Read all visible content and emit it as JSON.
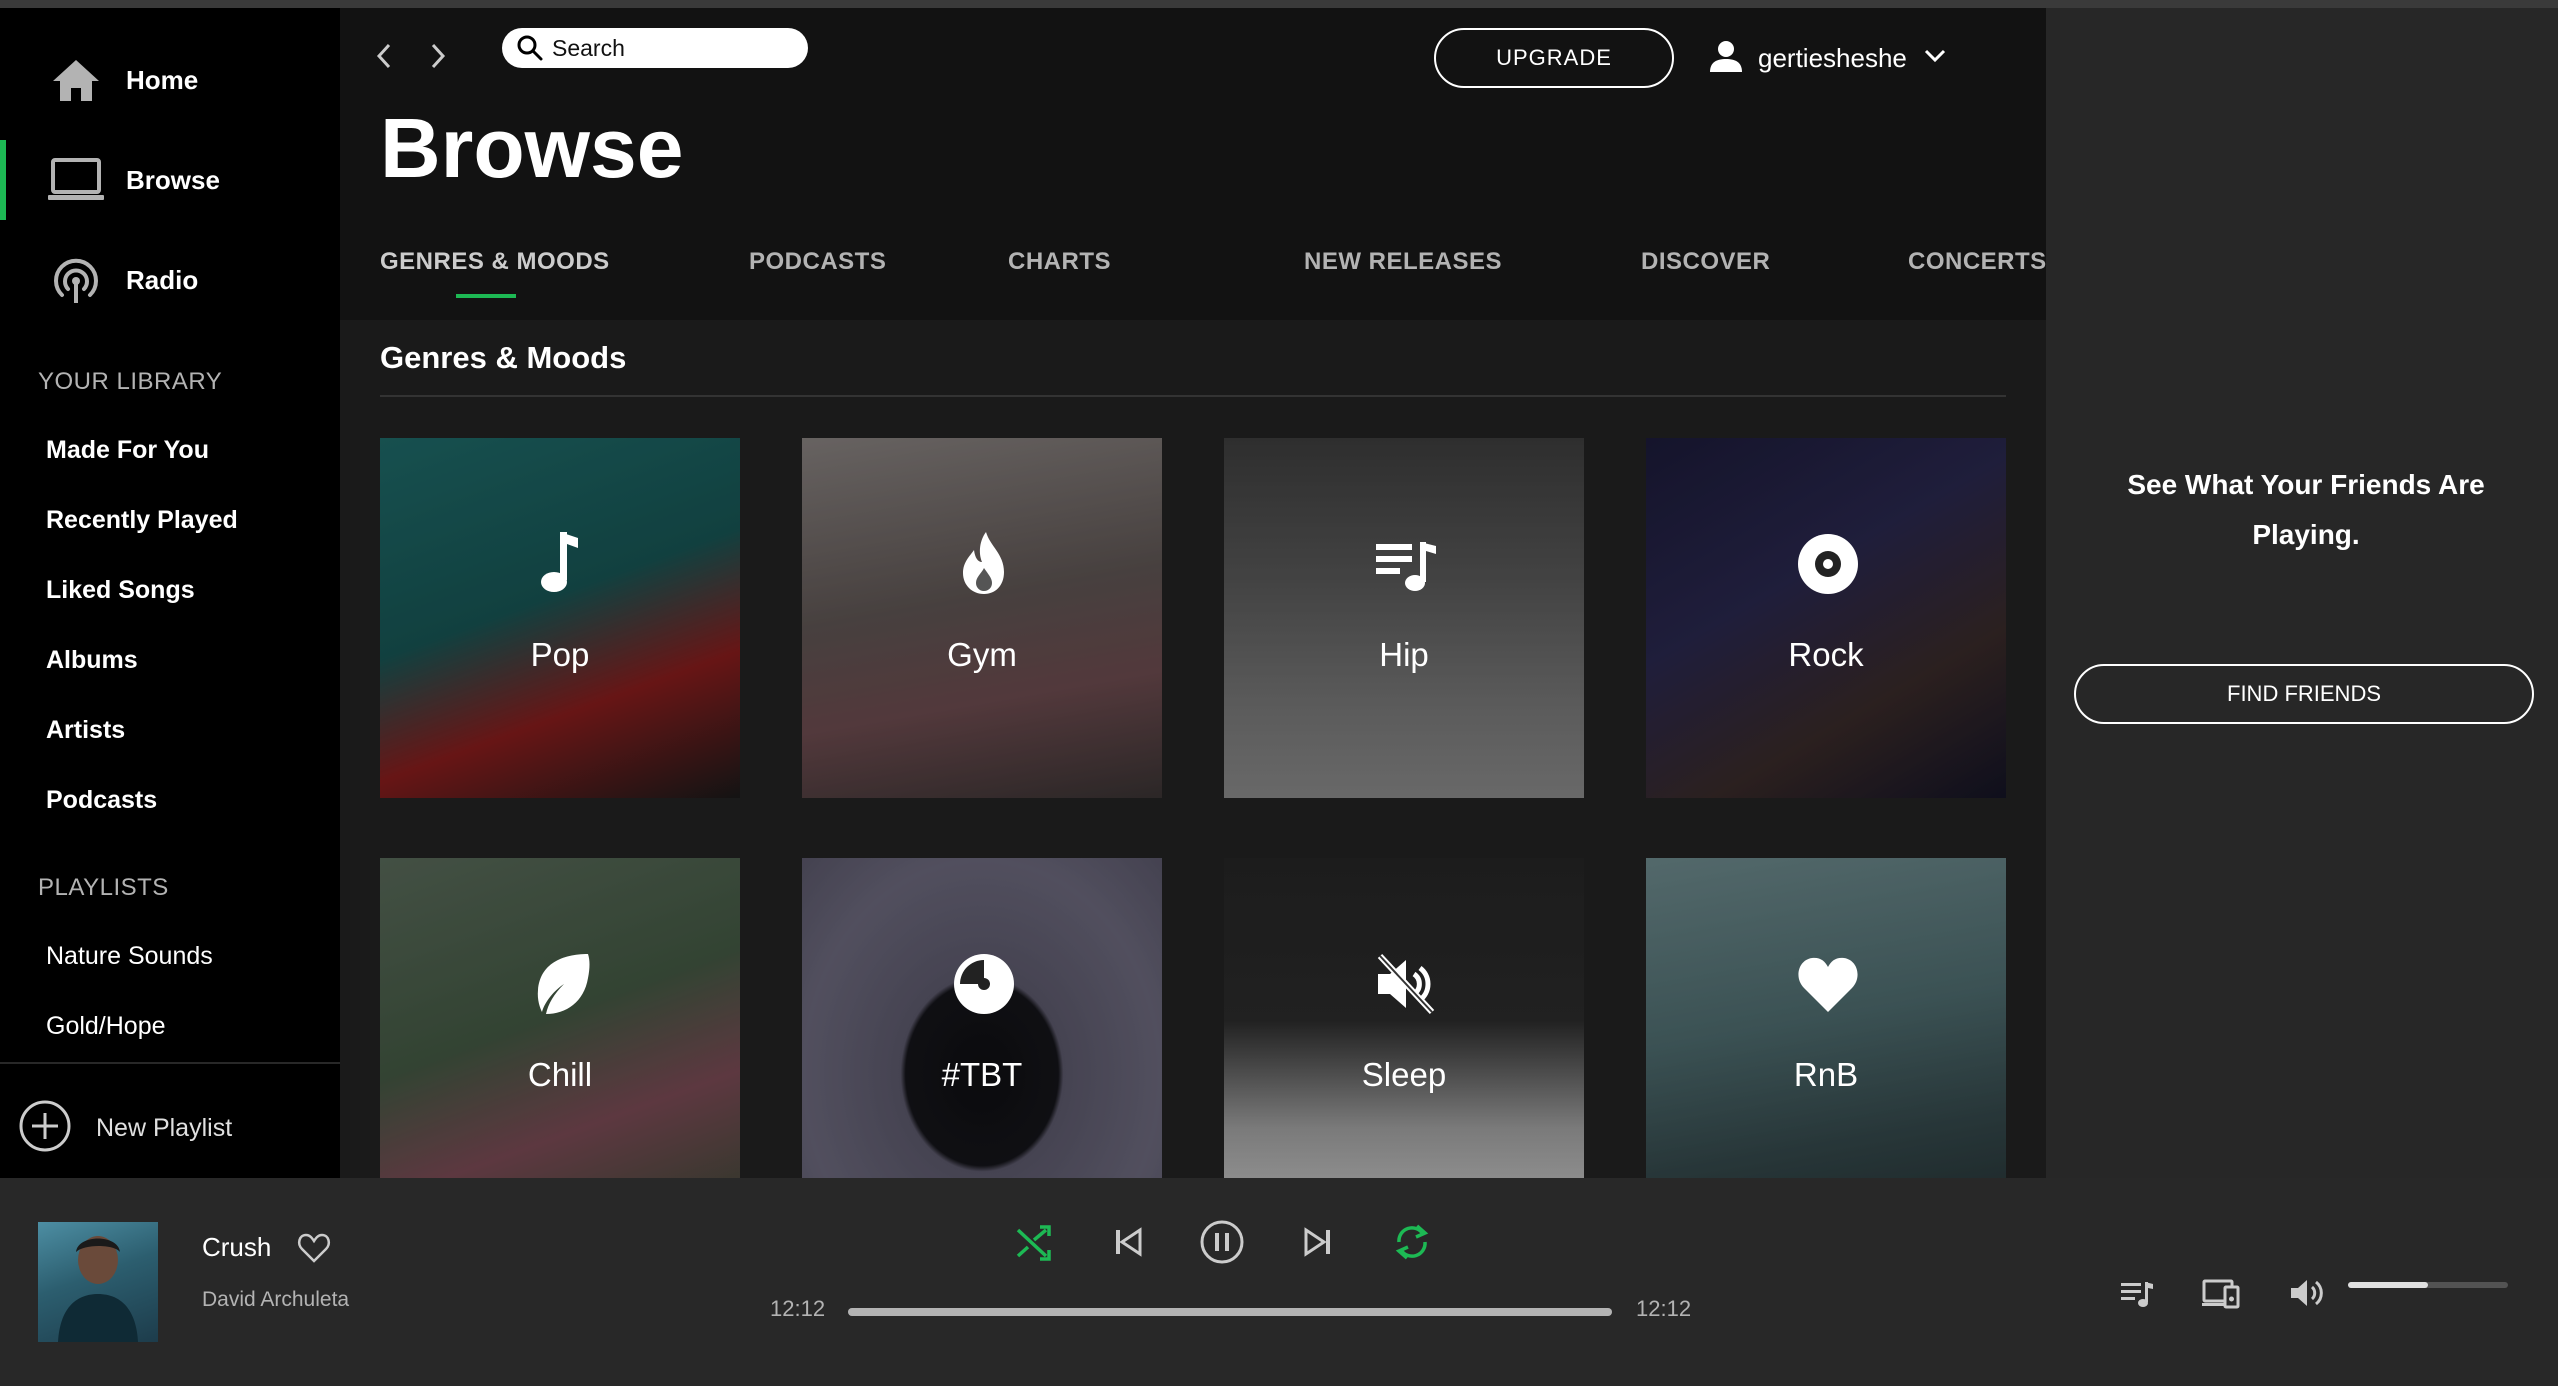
{
  "sidebar": {
    "nav": [
      {
        "label": "Home",
        "icon": "home-icon"
      },
      {
        "label": "Browse",
        "icon": "browse-icon",
        "active": true
      },
      {
        "label": "Radio",
        "icon": "radio-icon"
      }
    ],
    "library_heading": "YOUR LIBRARY",
    "library": [
      "Made For You",
      "Recently Played",
      "Liked Songs",
      "Albums",
      "Artists",
      "Podcasts"
    ],
    "playlists_heading": "PLAYLISTS",
    "playlists": [
      "Nature Sounds",
      "Gold/Hope"
    ],
    "new_playlist": "New Playlist"
  },
  "header": {
    "search_placeholder": "Search",
    "upgrade_label": "UPGRADE",
    "username": "gertiesheshe"
  },
  "main": {
    "title": "Browse",
    "tabs": [
      {
        "label": "GENRES & MOODS",
        "active": true
      },
      {
        "label": "PODCASTS"
      },
      {
        "label": "CHARTS"
      },
      {
        "label": "NEW RELEASES"
      },
      {
        "label": "DISCOVER"
      },
      {
        "label": "CONCERTS"
      }
    ],
    "section_title": "Genres & Moods",
    "tiles": [
      {
        "label": "Pop",
        "icon": "music-note-icon"
      },
      {
        "label": "Gym",
        "icon": "flame-icon"
      },
      {
        "label": "Hip",
        "icon": "playlist-icon"
      },
      {
        "label": "Rock",
        "icon": "vinyl-record-icon"
      },
      {
        "label": "Chill",
        "icon": "leaf-icon"
      },
      {
        "label": "#TBT",
        "icon": "pie-icon"
      },
      {
        "label": "Sleep",
        "icon": "mute-icon"
      },
      {
        "label": "RnB",
        "icon": "heart-icon"
      }
    ]
  },
  "friends": {
    "message": "See What Your Friends Are Playing.",
    "button": "FIND FRIENDS"
  },
  "player": {
    "track": "Crush",
    "artist": "David Archuleta",
    "elapsed": "12:12",
    "duration": "12:12",
    "progress": 1.0,
    "volume": 0.5,
    "accent": "#1db954"
  }
}
